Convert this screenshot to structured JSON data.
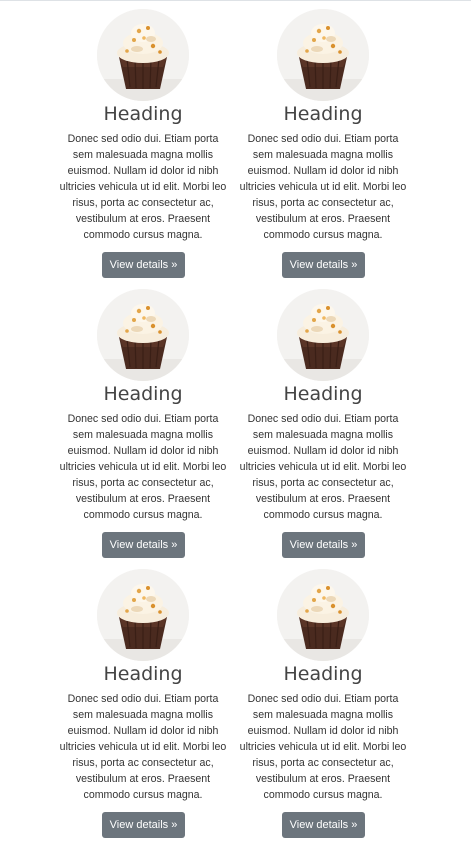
{
  "cards": [
    {
      "heading": "Heading",
      "body": "Donec sed odio dui. Etiam porta sem malesuada magna mollis euismod. Nullam id dolor id nibh ultricies vehicula ut id elit. Morbi leo risus, porta ac consectetur ac, vestibulum at eros. Praesent commodo cursus magna.",
      "button": "View details »",
      "image": "cupcake-image"
    },
    {
      "heading": "Heading",
      "body": "Donec sed odio dui. Etiam porta sem malesuada magna mollis euismod. Nullam id dolor id nibh ultricies vehicula ut id elit. Morbi leo risus, porta ac consectetur ac, vestibulum at eros. Praesent commodo cursus magna.",
      "button": "View details »",
      "image": "cupcake-image"
    },
    {
      "heading": "Heading",
      "body": "Donec sed odio dui. Etiam porta sem malesuada magna mollis euismod. Nullam id dolor id nibh ultricies vehicula ut id elit. Morbi leo risus, porta ac consectetur ac, vestibulum at eros. Praesent commodo cursus magna.",
      "button": "View details »",
      "image": "cupcake-image"
    },
    {
      "heading": "Heading",
      "body": "Donec sed odio dui. Etiam porta sem malesuada magna mollis euismod. Nullam id dolor id nibh ultricies vehicula ut id elit. Morbi leo risus, porta ac consectetur ac, vestibulum at eros. Praesent commodo cursus magna.",
      "button": "View details »",
      "image": "cupcake-image"
    },
    {
      "heading": "Heading",
      "body": "Donec sed odio dui. Etiam porta sem malesuada magna mollis euismod. Nullam id dolor id nibh ultricies vehicula ut id elit. Morbi leo risus, porta ac consectetur ac, vestibulum at eros. Praesent commodo cursus magna.",
      "button": "View details »",
      "image": "cupcake-image"
    },
    {
      "heading": "Heading",
      "body": "Donec sed odio dui. Etiam porta sem malesuada magna mollis euismod. Nullam id dolor id nibh ultricies vehicula ut id elit. Morbi leo risus, porta ac consectetur ac, vestibulum at eros. Praesent commodo cursus magna.",
      "button": "View details »",
      "image": "cupcake-image"
    }
  ],
  "colors": {
    "button_bg": "#6c757d",
    "button_text": "#ffffff",
    "heading": "#444444"
  }
}
